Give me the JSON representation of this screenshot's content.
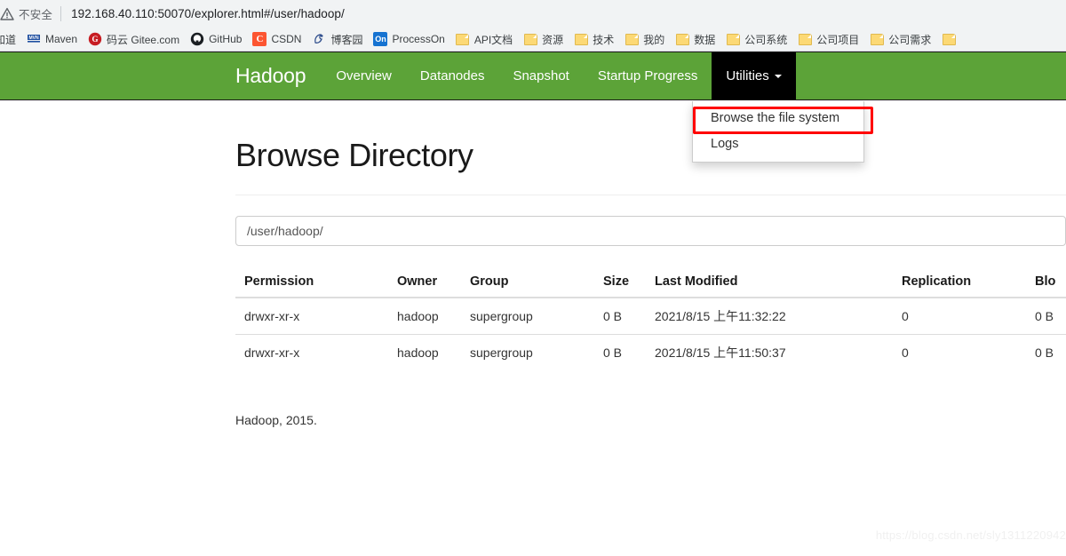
{
  "browser": {
    "security_label": "不安全",
    "security_icon": "warning-triangle-icon",
    "url": "192.168.40.110:50070/explorer.html#/user/hadoop/",
    "bookmarks": [
      {
        "label": "知道",
        "icon": "generic-site-icon",
        "icon_kind": "cut"
      },
      {
        "label": "Maven",
        "icon": "maven-icon",
        "icon_kind": "maven"
      },
      {
        "label": "码云 Gitee.com",
        "icon": "gitee-icon",
        "icon_kind": "gitee"
      },
      {
        "label": "GitHub",
        "icon": "github-icon",
        "icon_kind": "github"
      },
      {
        "label": "CSDN",
        "icon": "csdn-icon",
        "icon_kind": "csdn"
      },
      {
        "label": "博客园",
        "icon": "cnblogs-icon",
        "icon_kind": "cnblogs"
      },
      {
        "label": "ProcessOn",
        "icon": "processon-icon",
        "icon_kind": "processon"
      },
      {
        "label": "API文档",
        "icon": "folder-icon",
        "icon_kind": "folder"
      },
      {
        "label": "资源",
        "icon": "folder-icon",
        "icon_kind": "folder"
      },
      {
        "label": "技术",
        "icon": "folder-icon",
        "icon_kind": "folder"
      },
      {
        "label": "我的",
        "icon": "folder-icon",
        "icon_kind": "folder"
      },
      {
        "label": "数据",
        "icon": "folder-icon",
        "icon_kind": "folder"
      },
      {
        "label": "公司系统",
        "icon": "folder-icon",
        "icon_kind": "folder"
      },
      {
        "label": "公司项目",
        "icon": "folder-icon",
        "icon_kind": "folder"
      },
      {
        "label": "公司需求",
        "icon": "folder-icon",
        "icon_kind": "folder"
      },
      {
        "label": "",
        "icon": "folder-icon",
        "icon_kind": "folder"
      }
    ]
  },
  "navbar": {
    "brand": "Hadoop",
    "background_color": "#5ca338",
    "active_background_color": "#000000",
    "links": [
      {
        "label": "Overview",
        "active": false
      },
      {
        "label": "Datanodes",
        "active": false
      },
      {
        "label": "Snapshot",
        "active": false
      },
      {
        "label": "Startup Progress",
        "active": false
      },
      {
        "label": "Utilities",
        "active": true,
        "caret": true
      }
    ]
  },
  "dropdown": {
    "open": true,
    "highlight_color": "#ff0000",
    "items": [
      {
        "label": "Browse the file system",
        "highlighted": true
      },
      {
        "label": "Logs",
        "highlighted": false
      }
    ]
  },
  "main": {
    "title": "Browse Directory",
    "path_value": "/user/hadoop/",
    "path_placeholder": "",
    "table": {
      "headers": [
        "Permission",
        "Owner",
        "Group",
        "Size",
        "Last Modified",
        "Replication",
        "Blo"
      ],
      "rows": [
        {
          "permission": "drwxr-xr-x",
          "owner": "hadoop",
          "group": "supergroup",
          "size": "0 B",
          "last_modified": "2021/8/15 上午11:32:22",
          "replication": "0",
          "block_size": "0 B"
        },
        {
          "permission": "drwxr-xr-x",
          "owner": "hadoop",
          "group": "supergroup",
          "size": "0 B",
          "last_modified": "2021/8/15 上午11:50:37",
          "replication": "0",
          "block_size": "0 B"
        }
      ]
    },
    "footer": "Hadoop, 2015."
  },
  "watermark": "https://blog.csdn.net/sly1311220942"
}
